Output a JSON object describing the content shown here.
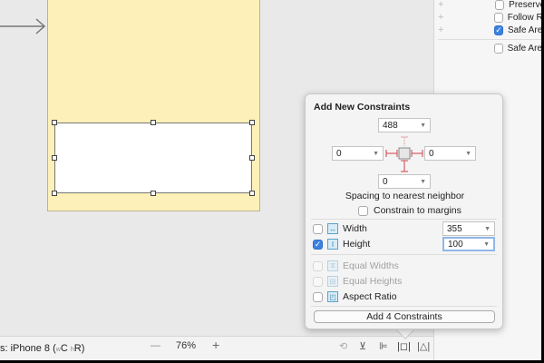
{
  "inspector": {
    "items": [
      {
        "label": "Preserve",
        "checked": false
      },
      {
        "label": "Follow Re",
        "checked": false
      },
      {
        "label": "Safe Area",
        "checked": true
      },
      {
        "label": "Safe Area",
        "checked": false
      }
    ]
  },
  "bottom_bar": {
    "device_label": "s: iPhone 8 (",
    "w_label": "w",
    "compact": "C",
    "h_label": "h",
    "regular": "R)",
    "zoom_out": "—",
    "zoom": "76%",
    "zoom_in": "+"
  },
  "popover": {
    "title": "Add New Constraints",
    "top": "488",
    "left": "0",
    "right": "0",
    "bottom": "0",
    "spacing_label": "Spacing to nearest neighbor",
    "constrain_margins": "Constrain to margins",
    "width_label": "Width",
    "width_value": "355",
    "width_checked": false,
    "height_label": "Height",
    "height_value": "100",
    "height_checked": true,
    "equal_widths": "Equal Widths",
    "equal_heights": "Equal Heights",
    "aspect_ratio": "Aspect Ratio",
    "add_button": "Add 4 Constraints"
  },
  "colors": {
    "accent": "#3b82e0",
    "scene": "#fdf0b8",
    "constraint": "#d0404a"
  }
}
